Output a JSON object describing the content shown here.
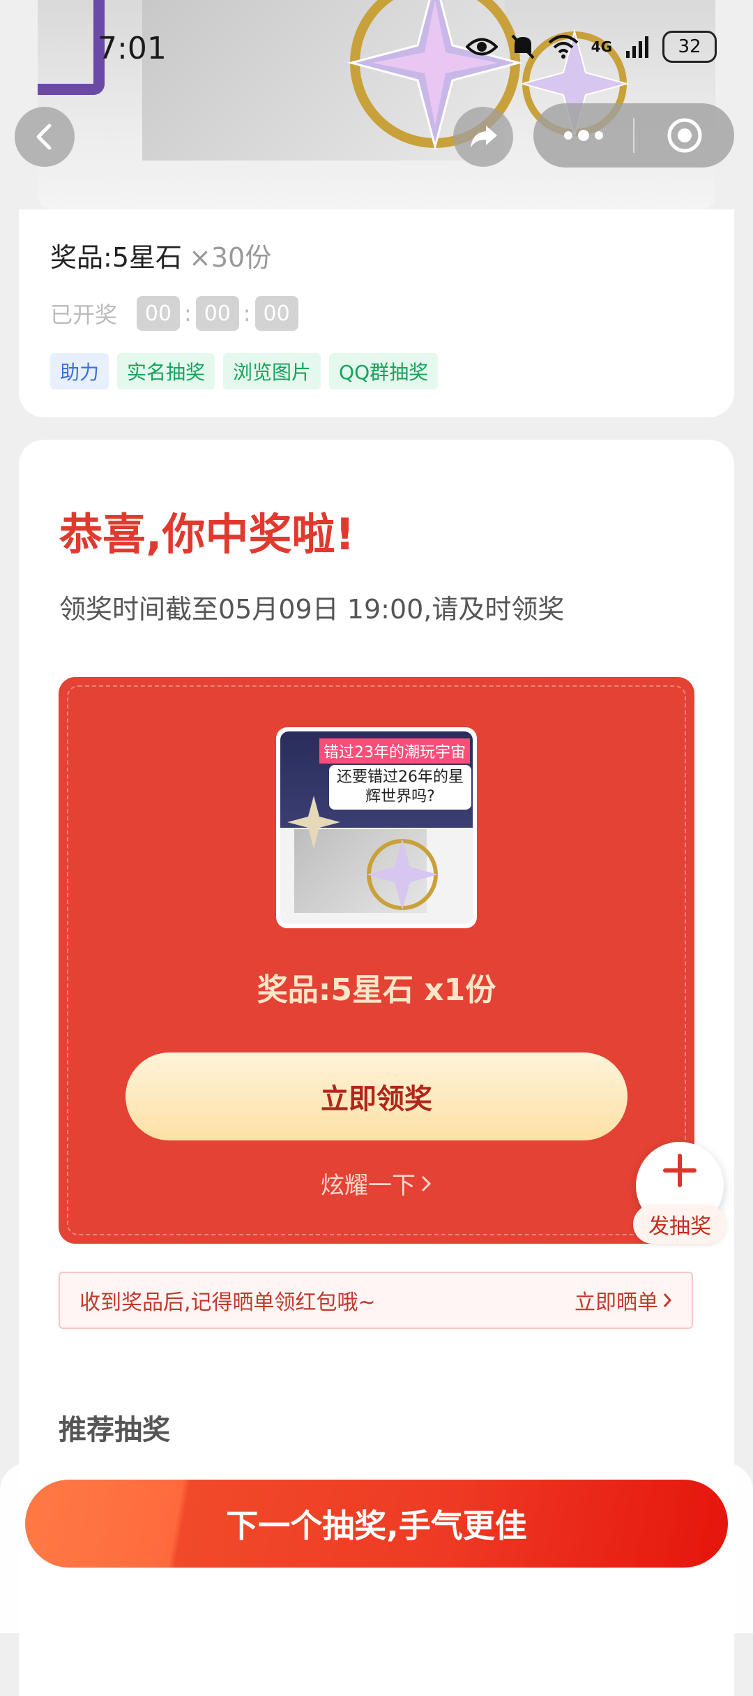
{
  "status_bar": {
    "time": "7:01",
    "network": "4G",
    "battery": "32"
  },
  "prize_info": {
    "label": "奖品:",
    "name": "5星石",
    "quantity": "×30份",
    "opened_label": "已开奖",
    "countdown": [
      "00",
      "00",
      "00"
    ],
    "tags": [
      {
        "label": "助力",
        "color": "blue"
      },
      {
        "label": "实名抽奖",
        "color": "green"
      },
      {
        "label": "浏览图片",
        "color": "green"
      },
      {
        "label": "QQ群抽奖",
        "color": "green"
      }
    ]
  },
  "result": {
    "title": "恭喜,你中奖啦!",
    "deadline": "领奖时间截至05月09日 19:00,请及时领奖",
    "thumbnail": {
      "banner_top": "错过23年的潮玩宇宙",
      "banner_bottom": "还要错过26年的星辉世界吗?"
    },
    "prize_text": "奖品:5星石 x1份",
    "claim_button": "立即领奖",
    "show_off": "炫耀一下"
  },
  "tip_bar": {
    "text": "收到奖品后,记得晒单领红包哦~",
    "action": "立即晒单"
  },
  "floating": {
    "label": "发抽奖"
  },
  "recommend": {
    "title": "推荐抽奖"
  },
  "bottom": {
    "next_button": "下一个抽奖,手气更佳"
  },
  "colors": {
    "accent_red": "#e44234",
    "title_red": "#e03a2f",
    "button_cream": "#fde1a6"
  }
}
